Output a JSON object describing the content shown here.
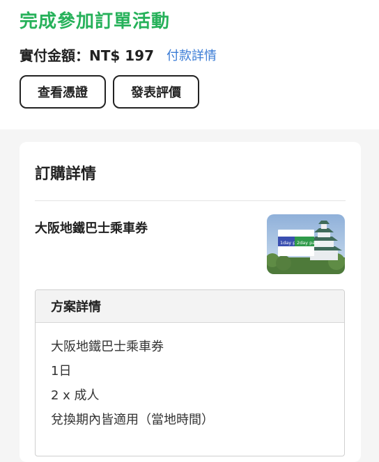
{
  "header": {
    "title": "完成參加訂單活動",
    "amount_label": "實付金額：NT$ 197",
    "pay_details_link": "付款詳情"
  },
  "actions": {
    "view_voucher": "查看憑證",
    "write_review": "發表評價"
  },
  "order": {
    "section_title": "訂購詳情",
    "product_name": "大阪地鐵巴士乘車券",
    "thumbnail_labels": [
      "1day pass",
      "2day pass"
    ],
    "plan": {
      "title": "方案詳情",
      "lines": [
        "大阪地鐵巴士乘車券",
        "1日",
        "2 x 成人",
        "兌換期內皆適用（當地時間）"
      ]
    }
  },
  "colors": {
    "brand_green": "#26b15a",
    "link_blue": "#3a7bd5"
  }
}
